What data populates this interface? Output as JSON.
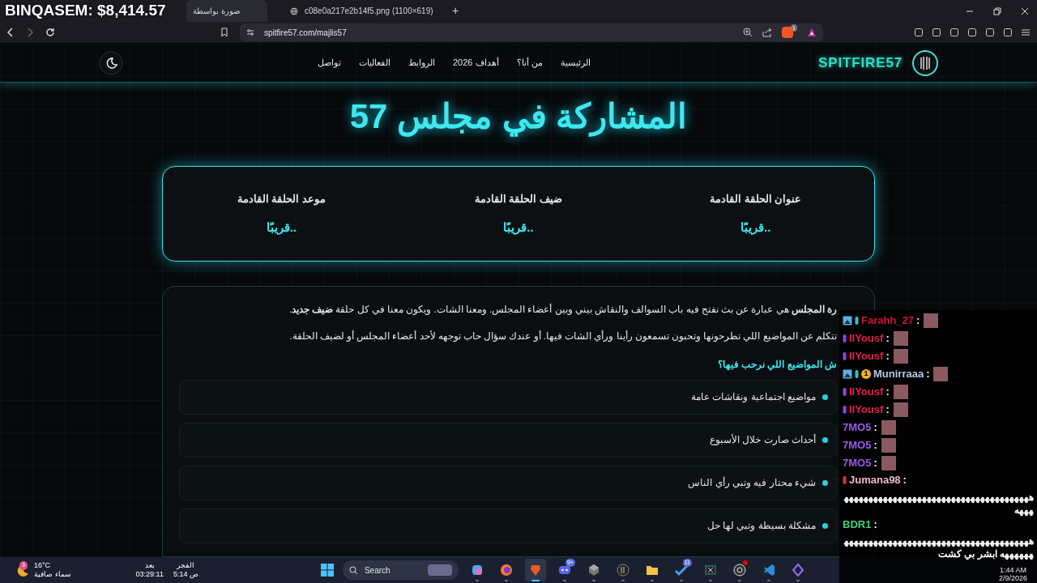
{
  "stream_overlay": {
    "balance": "BINQASEM: $8,414.57"
  },
  "browser": {
    "tabs": [
      {
        "title": "c08e0a217e2b14f5.png (1100×619)",
        "selected": false
      },
      {
        "title": "صورة بواسطة",
        "selected": true
      }
    ],
    "new_tab": "+",
    "url": "spitfire57.com/majlis57",
    "shields_count": "1"
  },
  "site": {
    "logo": "SPITFIRE57",
    "nav": [
      "الرئيسية",
      "من أنا؟",
      "أهداف 2026",
      "الروابط",
      "الفعاليات",
      "تواصل"
    ],
    "title": "المشاركة في مجلس 57",
    "next_episode": [
      {
        "label": "عنوان الحلقة القادمة",
        "value": "قريبًا.."
      },
      {
        "label": "ضيف الحلقة القادمة",
        "value": "قريبًا.."
      },
      {
        "label": "موعد الحلقة القادمة",
        "value": "قريبًا.."
      }
    ],
    "intro": [
      "**رة المجلس** هي عبارة عن بث نفتح فيه باب السوالف والنقاش بيني وبين أعضاء المجلس. ومعنا الشات. ويكون معنا في كل حلقة **ضيف جديد**.",
      "تتكلم عن المواضيع اللي تطرحونها وتحبون تسمعون رأينا ورأي الشات فيها. أو عندك سؤال حاب توجهه لأحد أعضاء المجلس أو لضيف الحلقة."
    ],
    "topics_heading": "ش المواضيع اللي نرحب فيها؟",
    "topics": [
      "مواضيع اجتماعية ونقاشات عامة",
      "أحداث صارت خلال الأسبوع",
      "شيء محتار فيه وتبي رأي الناس",
      "مشكلة بسيطة وتبي لها حل"
    ]
  },
  "chat": {
    "messages": [
      {
        "user": "Farahh_27",
        "separator": ":",
        "color": "#d0103a",
        "badges": [
          {
            "kind": "image"
          },
          {
            "kind": "ticket"
          }
        ],
        "kind": "emote"
      },
      {
        "user": "IIYousf",
        "separator": ":",
        "color": "#e0204a",
        "badges": [
          {
            "kind": "bar"
          }
        ],
        "kind": "emote"
      },
      {
        "user": "IIYousf",
        "separator": ":",
        "color": "#e0204a",
        "badges": [
          {
            "kind": "bar"
          }
        ],
        "kind": "emote"
      },
      {
        "user": "Munirraaa",
        "separator": ":",
        "color": "#b8c8ea",
        "badges": [
          {
            "kind": "image"
          },
          {
            "kind": "ticket"
          },
          {
            "kind": "bits",
            "label": "1"
          }
        ],
        "kind": "emote"
      },
      {
        "user": "IIYousf",
        "separator": ":",
        "color": "#e0204a",
        "badges": [
          {
            "kind": "bar"
          }
        ],
        "kind": "emote"
      },
      {
        "user": "IIYousf",
        "separator": ":",
        "color": "#e0204a",
        "badges": [
          {
            "kind": "bar"
          }
        ],
        "kind": "emote"
      },
      {
        "user": "7MO5",
        "separator": ":",
        "color": "#9b5ae6",
        "kind": "emote"
      },
      {
        "user": "7MO5",
        "separator": ":",
        "color": "#9b5ae6",
        "kind": "emote"
      },
      {
        "user": "7MO5",
        "separator": ":",
        "color": "#9b5ae6",
        "kind": "emote"
      },
      {
        "user": "Jumana98",
        "separator": ":",
        "color": "#f2b8c6",
        "badges": [
          {
            "kind": "red"
          }
        ],
        "kind": "text",
        "text": "ههههههههههههههههههههههههههههههههههههههههههه"
      },
      {
        "user": "BDR1",
        "separator": ":",
        "color": "#40d080",
        "kind": "text",
        "text": "هههههههههههههههههههههههههههههههههههههههههههههه ابشر بي كشت"
      }
    ]
  },
  "taskbar": {
    "weather": {
      "temp": "16°C",
      "sky": "سماء صافية",
      "alerts": "3"
    },
    "prayer": [
      {
        "name": "الفجر",
        "time": "5:14 ص"
      },
      {
        "name": "بعد",
        "time": "03:29:11"
      }
    ],
    "search": "Search",
    "apps": [
      {
        "kind": "diamond",
        "active": false
      },
      {
        "kind": "code",
        "active": false
      },
      {
        "kind": "aperture",
        "active": false,
        "dot": true
      },
      {
        "kind": "sheet",
        "active": false
      },
      {
        "kind": "check",
        "active": false,
        "badge": "11"
      },
      {
        "kind": "folder",
        "active": false
      },
      {
        "kind": "disc",
        "active": false
      },
      {
        "kind": "cube",
        "active": false
      },
      {
        "kind": "discord",
        "active": false,
        "badge": "9+"
      },
      {
        "kind": "brave",
        "active": true
      },
      {
        "kind": "firefox",
        "active": false
      },
      {
        "kind": "copilot",
        "active": false
      }
    ],
    "time": "1:44 AM",
    "date": "2/9/2026"
  }
}
